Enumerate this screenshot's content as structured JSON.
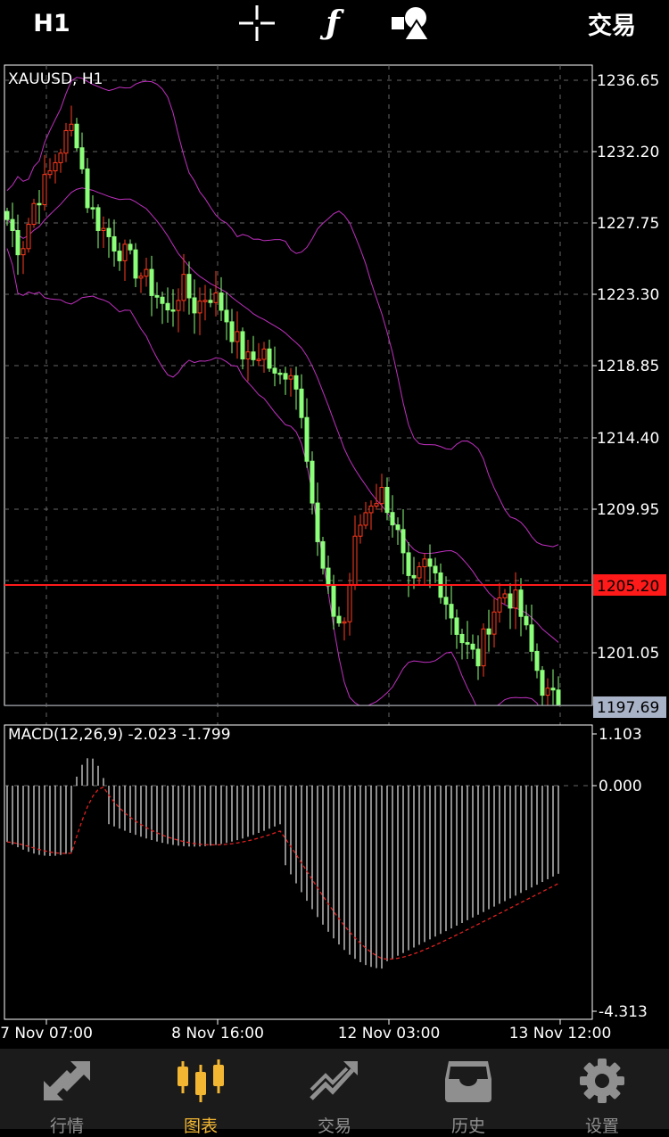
{
  "toolbar": {
    "timeframe": "H1",
    "crosshair_icon": "crosshair-icon",
    "indicator_icon": "function-icon",
    "objects_icon": "shapes-icon",
    "trade_label": "交易"
  },
  "chart": {
    "symbol_label": "XAUUSD, H1",
    "price_scale": [
      "1236.65",
      "1232.20",
      "1227.75",
      "1223.30",
      "1218.85",
      "1214.40",
      "1209.95",
      "1205.20",
      "1201.05",
      "1197.69"
    ],
    "current_price": "1205.20",
    "bid_price": "1197.69",
    "macd_label": "MACD(12,26,9) -2.023 -1.799",
    "macd_scale": [
      "1.103",
      "0.000",
      "-4.313"
    ],
    "time_labels": [
      "7 Nov 07:00",
      "8 Nov 16:00",
      "12 Nov 03:00",
      "13 Nov 12:00"
    ],
    "colors": {
      "up_candle": "#ff3b1f",
      "down_candle": "#8cff7a",
      "bands": "#c030c0",
      "price_line": "#ff1a1a",
      "macd_signal": "#e02020"
    }
  },
  "chart_data": {
    "type": "candlestick",
    "symbol": "XAUUSD",
    "timeframe": "H1",
    "ylim": [
      1197.69,
      1237.4
    ],
    "y_ticks": [
      1236.65,
      1232.2,
      1227.75,
      1223.3,
      1218.85,
      1214.4,
      1209.95,
      1201.05
    ],
    "current_price": 1205.2,
    "bid": 1197.69,
    "x_labels": [
      "7 Nov 07:00",
      "8 Nov 16:00",
      "12 Nov 03:00",
      "13 Nov 12:00"
    ],
    "close_path": [
      1228,
      1226,
      1229,
      1230.5,
      1232.5,
      1234,
      1229,
      1227.5,
      1226.5,
      1225.5,
      1224.5,
      1223.5,
      1222,
      1224,
      1222.5,
      1223.5,
      1222.5,
      1220.5,
      1219,
      1220,
      1217.8,
      1219,
      1216,
      1208,
      1204,
      1202.5,
      1208.5,
      1210.5,
      1211,
      1208.5,
      1204.5,
      1206.5,
      1205.8,
      1203.5,
      1201.5,
      1200.5,
      1203.5,
      1204.8,
      1204,
      1201,
      1198.5,
      1197.8
    ],
    "macd": {
      "ylim": [
        -4.313,
        1.103
      ],
      "histogram_end": -1.9,
      "signal_end": -1.799,
      "macd_value": -2.023,
      "signal_value": -1.799
    }
  },
  "tabs": [
    {
      "label": "行情",
      "icon": "quotes-icon",
      "active": false
    },
    {
      "label": "图表",
      "icon": "chart-candles-icon",
      "active": true
    },
    {
      "label": "交易",
      "icon": "trade-icon",
      "active": false
    },
    {
      "label": "历史",
      "icon": "history-icon",
      "active": false
    },
    {
      "label": "设置",
      "icon": "settings-gear-icon",
      "active": false
    }
  ]
}
